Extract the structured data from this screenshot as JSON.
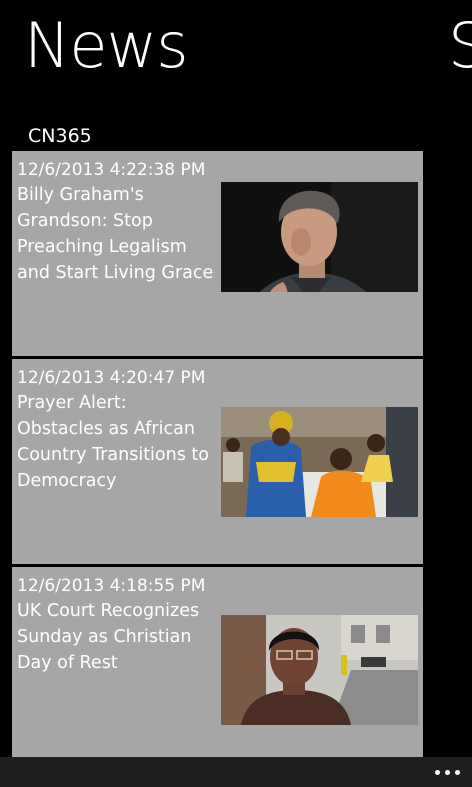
{
  "header": {
    "title": "News",
    "next_section_title": "S"
  },
  "feed": {
    "source": "CN365",
    "items": [
      {
        "date": "12/6/2013 4:22:38 PM",
        "headline": "Billy Graham's Grandson: Stop Preaching Legalism and Start Living Grace"
      },
      {
        "date": "12/6/2013 4:20:47 PM",
        "headline": "Prayer Alert: Obstacles as African Country Transitions to Democracy"
      },
      {
        "date": "12/6/2013 4:18:55 PM",
        "headline": "UK Court Recognizes Sunday as Christian Day of Rest"
      }
    ]
  },
  "app_bar": {
    "more_icon": "ellipsis-icon"
  },
  "colors": {
    "background": "#000000",
    "tile": "#a6a6a6",
    "text": "#ffffff",
    "app_bar": "#1f1f1f"
  }
}
